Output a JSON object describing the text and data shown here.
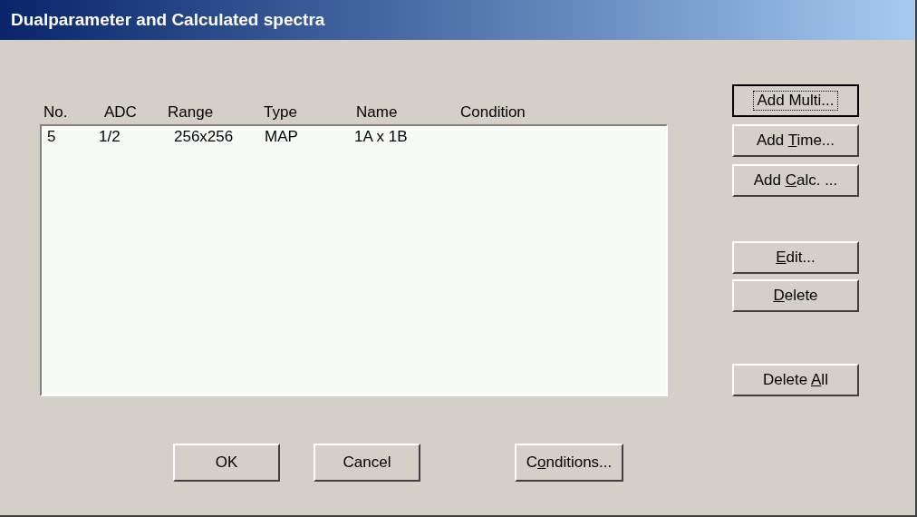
{
  "window": {
    "title": "Dualparameter and Calculated spectra"
  },
  "list": {
    "columns": [
      "No.",
      "ADC",
      "Range",
      "Type",
      "Name",
      "Condition"
    ],
    "rows": [
      [
        "5",
        "1/2",
        "256x256",
        "MAP",
        "1A x 1B"
      ]
    ]
  },
  "side_buttons": [
    {
      "after": "Add Multi...",
      "default": true
    },
    {
      "before": "Add ",
      "key": "T",
      "after": "ime...",
      "default": false
    },
    {
      "before": "Add ",
      "key": "C",
      "after": "alc. ...",
      "default": false
    },
    {
      "key": "E",
      "after": "dit...",
      "default": false
    },
    {
      "key": "D",
      "after": "elete",
      "default": false
    },
    {
      "before": "Delete ",
      "key": "A",
      "after": "ll",
      "default": false
    }
  ],
  "bottom_buttons": [
    {
      "after": "OK",
      "default": false
    },
    {
      "after": "Cancel",
      "default": false
    },
    {
      "before": "C",
      "key": "o",
      "after": "nditions...",
      "default": false
    }
  ]
}
